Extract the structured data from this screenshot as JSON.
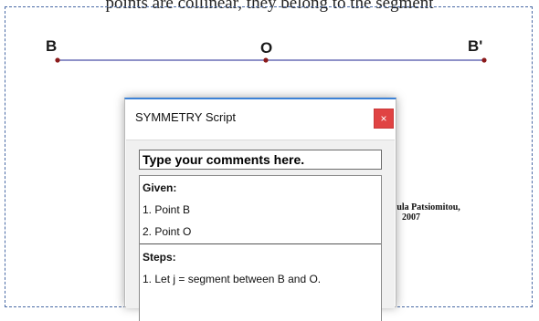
{
  "background": {
    "caption": "points are collinear, they belong to the segment"
  },
  "points": [
    {
      "label": "B"
    },
    {
      "label": "O"
    },
    {
      "label": "B'"
    }
  ],
  "colors": {
    "segment": "#4a4fa8",
    "point": "#8b1a1a",
    "dialog_accent": "#3c82d6",
    "close": "#e04343"
  },
  "copyright": {
    "line1": "© Stavroula Patsiomitou,",
    "line2": "2007"
  },
  "dialog": {
    "title": "SYMMETRY Script",
    "close_glyph": "×",
    "comment_value": "Type your comments here.",
    "given": {
      "heading": "Given:",
      "items": [
        "1. Point B",
        "2. Point O"
      ]
    },
    "steps": {
      "heading": "Steps:",
      "items": [
        "1. Let j = segment between B and O."
      ]
    }
  }
}
